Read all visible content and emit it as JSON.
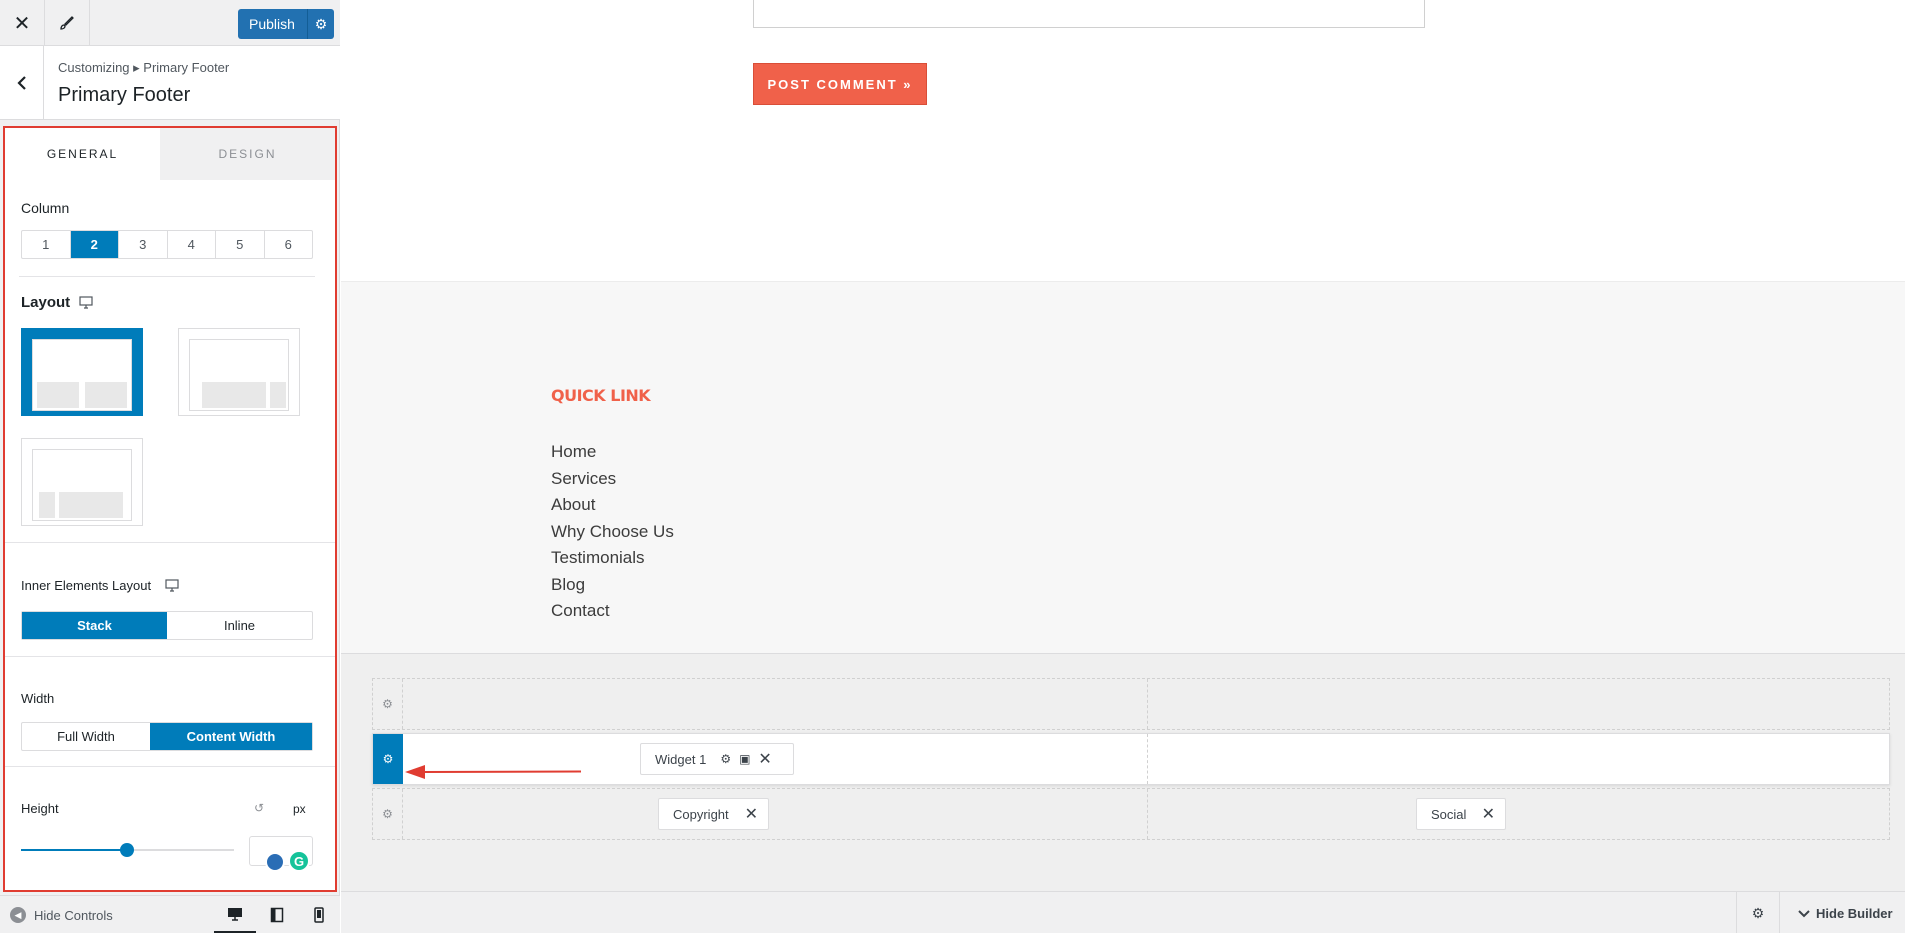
{
  "topbar": {
    "publish_label": "Publish"
  },
  "section": {
    "breadcrumb": "Customizing ▸ Primary Footer",
    "title": "Primary Footer"
  },
  "tabs": {
    "general": "GENERAL",
    "design": "DESIGN"
  },
  "column": {
    "label": "Column",
    "options": [
      "1",
      "2",
      "3",
      "4",
      "5",
      "6"
    ],
    "selected": "2"
  },
  "layout": {
    "label": "Layout"
  },
  "inner_layout": {
    "label": "Inner Elements Layout",
    "options": [
      "Stack",
      "Inline"
    ],
    "selected": "Stack"
  },
  "width": {
    "label": "Width",
    "options": [
      "Full Width",
      "Content Width"
    ],
    "selected": "Content Width"
  },
  "height": {
    "label": "Height",
    "unit": "px",
    "slider_level": 0.5
  },
  "controls": {
    "hide_controls": "Hide Controls"
  },
  "preview": {
    "post_comment": "POST COMMENT »",
    "quick_link_title": "QUICK LINK",
    "links": [
      "Home",
      "Services",
      "About",
      "Why Choose Us",
      "Testimonials",
      "Blog",
      "Contact"
    ]
  },
  "builder": {
    "widget1": "Widget 1",
    "copyright": "Copyright",
    "social": "Social",
    "hide_builder": "Hide Builder"
  },
  "colors": {
    "accent": "#007cba",
    "brand": "#f0614a",
    "highlight_border": "#e03c31"
  }
}
